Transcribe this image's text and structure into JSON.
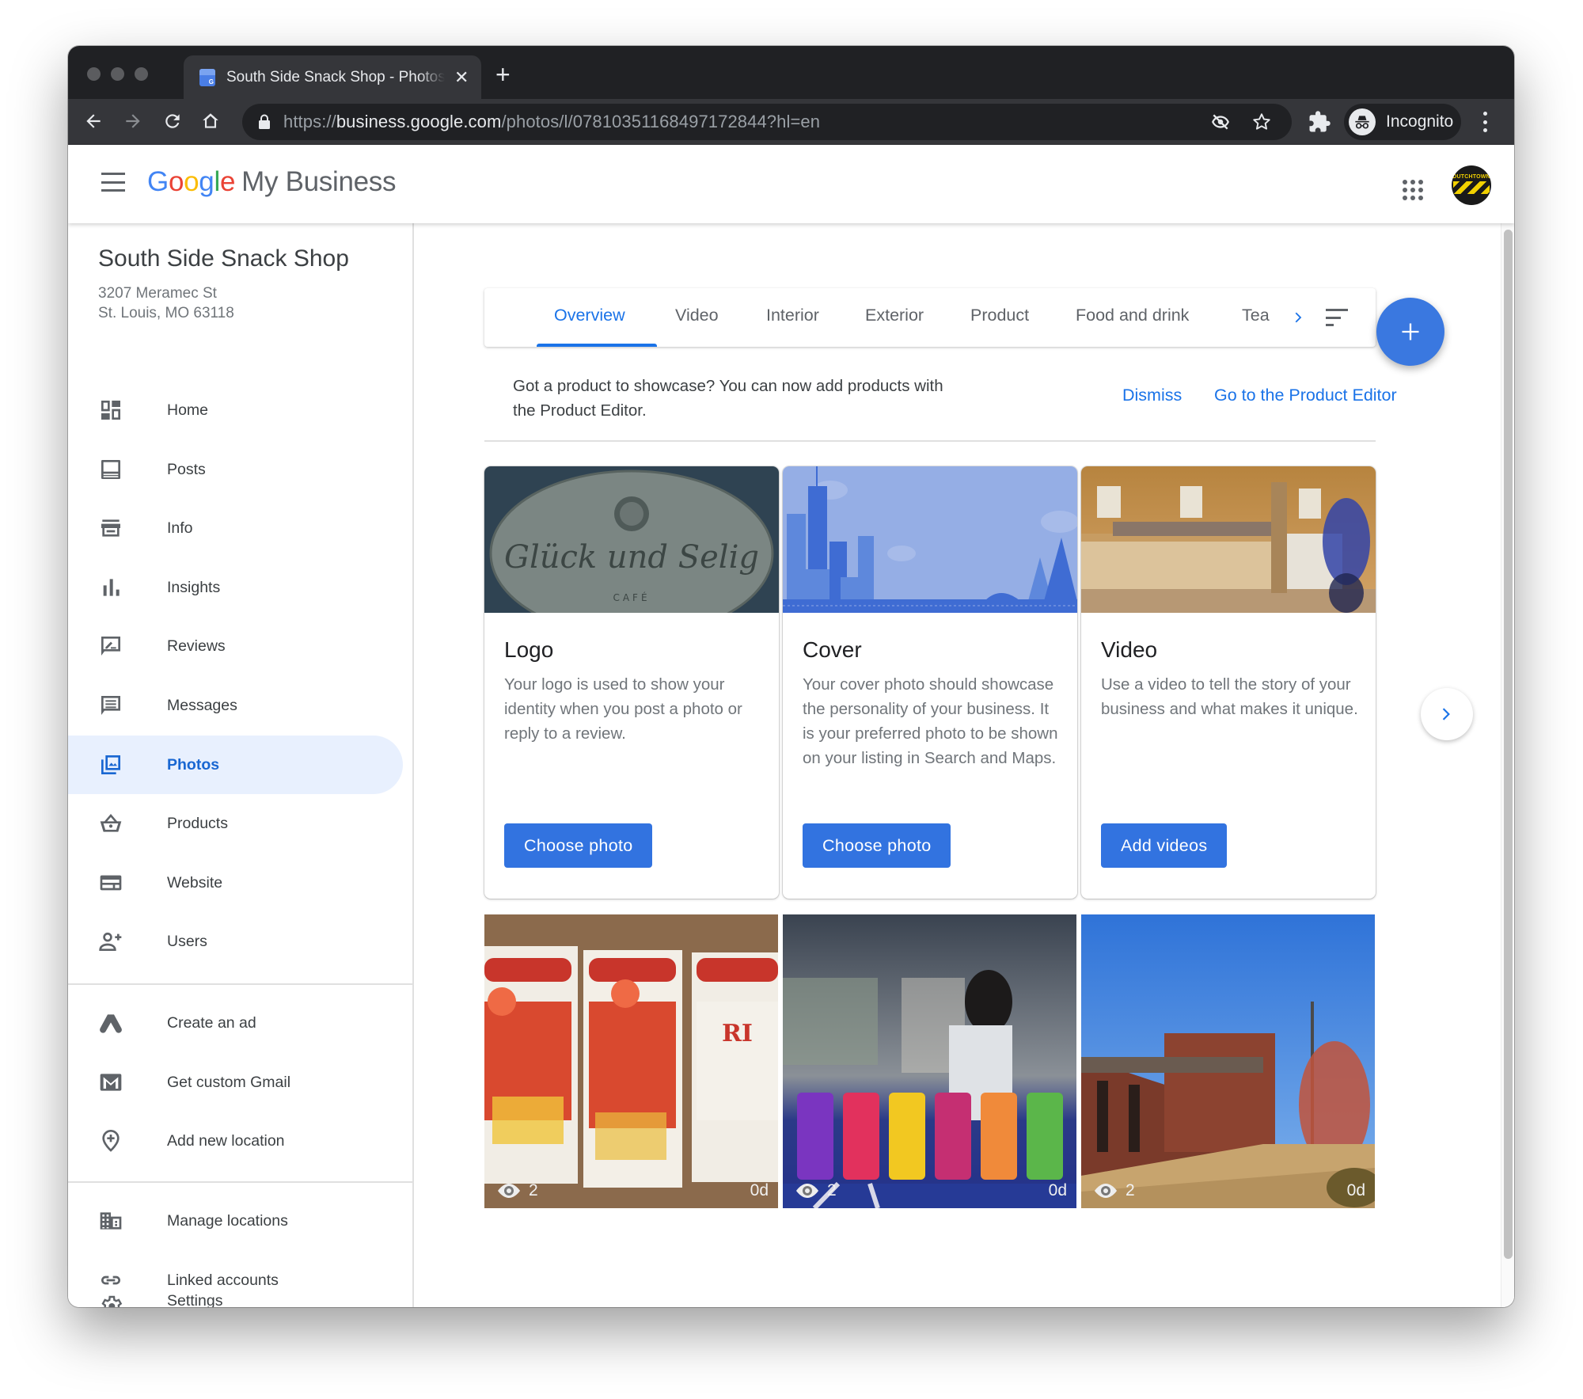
{
  "browser": {
    "tab_title": "South Side Snack Shop - Photos",
    "new_tab_label": "+",
    "url_scheme": "https://",
    "url_host": "business.google.com",
    "url_path": "/photos/l/07810351168497172844?hl=en",
    "profile_label": "Incognito"
  },
  "app": {
    "brand_google": [
      "G",
      "o",
      "o",
      "g",
      "l",
      "e"
    ],
    "brand_product": "My Business"
  },
  "business": {
    "name": "South Side Snack Shop",
    "address_line1": "3207 Meramec St",
    "address_line2": "St. Louis, MO 63118"
  },
  "sidebar": {
    "items": [
      {
        "label": "Home",
        "icon": "dashboard-icon"
      },
      {
        "label": "Posts",
        "icon": "posts-icon"
      },
      {
        "label": "Info",
        "icon": "storefront-icon"
      },
      {
        "label": "Insights",
        "icon": "bar-chart-icon"
      },
      {
        "label": "Reviews",
        "icon": "rate-review-icon"
      },
      {
        "label": "Messages",
        "icon": "chat-icon"
      },
      {
        "label": "Photos",
        "icon": "photo-library-icon",
        "active": true
      },
      {
        "label": "Products",
        "icon": "basket-icon"
      },
      {
        "label": "Website",
        "icon": "web-icon"
      },
      {
        "label": "Users",
        "icon": "person-add-icon"
      }
    ],
    "secondary_items": [
      {
        "label": "Create an ad",
        "icon": "google-ads-icon"
      },
      {
        "label": "Get custom Gmail",
        "icon": "gmail-icon"
      },
      {
        "label": "Add new location",
        "icon": "add-location-icon"
      }
    ],
    "tertiary_items": [
      {
        "label": "Manage locations",
        "icon": "domain-icon"
      },
      {
        "label": "Linked accounts",
        "icon": "link-icon"
      },
      {
        "label": "Settings",
        "icon": "gear-icon"
      }
    ]
  },
  "photo_tabs": {
    "items": [
      "Overview",
      "Video",
      "Interior",
      "Exterior",
      "Product",
      "Food and drink",
      "Tea"
    ],
    "active": "Overview"
  },
  "banner": {
    "text": "Got a product to showcase? You can now add products with the Product Editor.",
    "dismiss_label": "Dismiss",
    "action_label": "Go to the Product Editor"
  },
  "cards": [
    {
      "title": "Logo",
      "description": "Your logo is used to show your identity when you post a photo or reply to a review.",
      "button": "Choose photo"
    },
    {
      "title": "Cover",
      "description": "Your cover photo should showcase the personality of your business. It is your preferred photo to be shown on your listing in Search and Maps.",
      "button": "Choose photo"
    },
    {
      "title": "Video",
      "description": "Use a video to tell the story of your business and what makes it unique.",
      "button": "Add videos"
    }
  ],
  "logo_image_text": {
    "script": "Glück und Selig",
    "sub": "CAFÉ"
  },
  "thumbnails": [
    {
      "subject": "chips",
      "views": "2",
      "age": "0d"
    },
    {
      "subject": "soda-cans",
      "views": "2",
      "age": "0d"
    },
    {
      "subject": "storefront",
      "views": "2",
      "age": "0d"
    }
  ],
  "avatar_text": "DUTCHTOWN",
  "colors": {
    "accent": "#1a73e8",
    "button": "#3273e0",
    "active_nav_bg": "#e8f0fe",
    "chrome_dark": "#202124"
  }
}
